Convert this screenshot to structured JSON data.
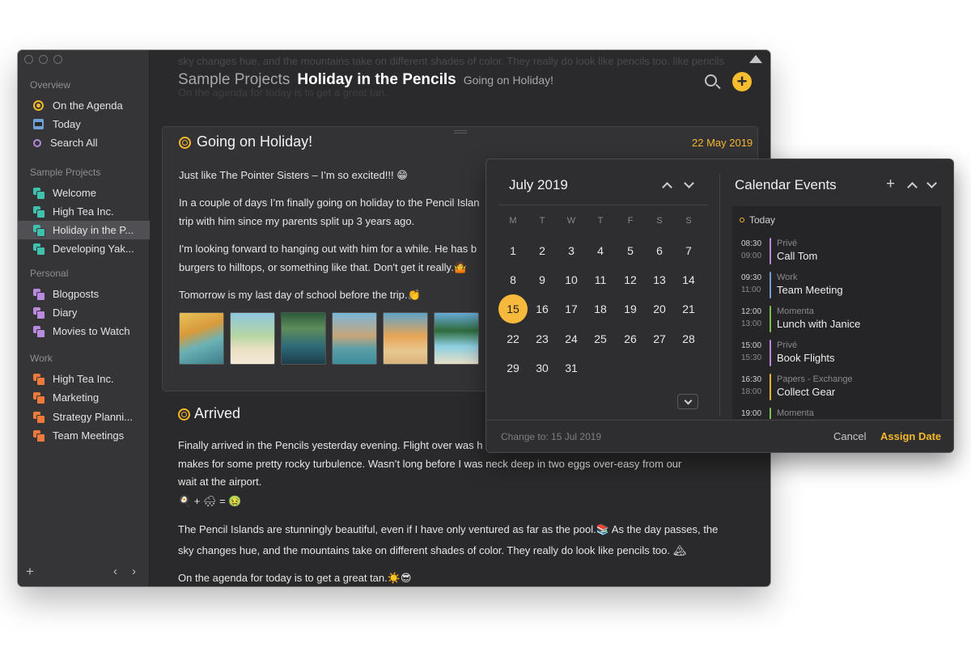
{
  "sidebar": {
    "sections": [
      {
        "title": "Overview",
        "items": [
          {
            "label": "On the Agenda",
            "icon": "agenda-icon"
          },
          {
            "label": "Today",
            "icon": "calendar-today-icon"
          },
          {
            "label": "Search All",
            "icon": "search-icon"
          }
        ]
      },
      {
        "title": "Sample Projects",
        "items": [
          {
            "label": "Welcome",
            "icon": "project-icon"
          },
          {
            "label": "High Tea Inc.",
            "icon": "project-icon"
          },
          {
            "label": "Holiday in the P...",
            "icon": "project-icon",
            "selected": true
          },
          {
            "label": "Developing Yak...",
            "icon": "project-icon"
          }
        ]
      },
      {
        "title": "Personal",
        "items": [
          {
            "label": "Blogposts",
            "icon": "project-icon"
          },
          {
            "label": "Diary",
            "icon": "project-icon"
          },
          {
            "label": "Movies to Watch",
            "icon": "project-icon"
          }
        ]
      },
      {
        "title": "Work",
        "items": [
          {
            "label": "High Tea Inc.",
            "icon": "project-icon"
          },
          {
            "label": "Marketing",
            "icon": "project-icon"
          },
          {
            "label": "Strategy Planni...",
            "icon": "project-icon"
          },
          {
            "label": "Team Meetings",
            "icon": "project-icon"
          }
        ]
      }
    ],
    "footer": {
      "add": "+",
      "back": "‹",
      "forward": "›"
    }
  },
  "header": {
    "project": "Sample Projects",
    "title": "Holiday in the Pencils",
    "current_heading": "Going on Holiday!",
    "add_label": "+",
    "ghost_text_top": "sky changes hue, and the mountains take on different shades of color. They really do look like pencils too. like pencils",
    "ghost_text_bottom": "On the agenda for today is to get a great tan."
  },
  "note_one": {
    "heading": "Going on Holiday!",
    "date": "22 May 2019",
    "paragraphs": [
      "Just like The Pointer Sisters – I’m so excited!!! 😁",
      "In a couple of days I’m finally going on holiday to the Pencil Islan",
      "trip with him since my parents split up 3 years ago.",
      "I'm looking forward to hanging out with him for a while. He has b",
      "burgers to hilltops, or something like that. Don't get it really.🤷",
      "Tomorrow is my last day of school before the trip.👏"
    ]
  },
  "note_two": {
    "heading": "Arrived",
    "paragraphs": [
      "Finally arrived in the Pencils yesterday evening. Flight over was h",
      "makes for some pretty rocky turbulence. Wasn’t long before I was neck deep in two eggs over-easy from our",
      "wait at the airport.",
      "🍳 + 🌨 = 🤢",
      "The Pencil Islands are stunningly beautiful, even if I have only ventured as far as the pool.📚 As the day passes, the",
      "sky changes hue, and the mountains take on different shades of color. They really do look like pencils too. 🏔",
      "On the agenda for today is to get a great tan.☀️😎"
    ]
  },
  "calendar": {
    "month": "July 2019",
    "weekdays": [
      "M",
      "T",
      "W",
      "T",
      "F",
      "S",
      "S"
    ],
    "days": [
      [
        "1",
        "2",
        "3",
        "4",
        "5",
        "6",
        "7"
      ],
      [
        "8",
        "9",
        "10",
        "11",
        "12",
        "13",
        "14"
      ],
      [
        "15",
        "16",
        "17",
        "18",
        "19",
        "20",
        "21"
      ],
      [
        "22",
        "23",
        "24",
        "25",
        "26",
        "27",
        "28"
      ],
      [
        "29",
        "30",
        "31",
        "",
        "",
        "",
        ""
      ]
    ],
    "selected_day": "15"
  },
  "events": {
    "title": "Calendar Events",
    "add_label": "+",
    "today_label": "Today",
    "items": [
      {
        "start": "08:30",
        "end": "09:00",
        "calendar": "Privé",
        "name": "Call Tom",
        "color": "#b98ae0"
      },
      {
        "start": "09:30",
        "end": "11:00",
        "calendar": "Work",
        "name": "Team Meeting",
        "color": "#6fa0d8"
      },
      {
        "start": "12:00",
        "end": "13:00",
        "calendar": "Momenta",
        "name": "Lunch with Janice",
        "color": "#7cc34a"
      },
      {
        "start": "15:00",
        "end": "15:30",
        "calendar": "Privé",
        "name": "Book Flights",
        "color": "#b98ae0"
      },
      {
        "start": "16:30",
        "end": "18:00",
        "calendar": "Papers - Exchange",
        "name": "Collect Gear",
        "color": "#f0b62e"
      },
      {
        "start": "19:00",
        "end": "",
        "calendar": "Momenta",
        "name": "",
        "color": "#7cc34a"
      }
    ]
  },
  "popover_footer": {
    "change_to": "Change to: 15 Jul 2019",
    "cancel": "Cancel",
    "assign": "Assign Date"
  },
  "colors": {
    "accent": "#f5b82a",
    "window_bg": "#2a2a2c",
    "sidebar_bg": "#353538"
  }
}
